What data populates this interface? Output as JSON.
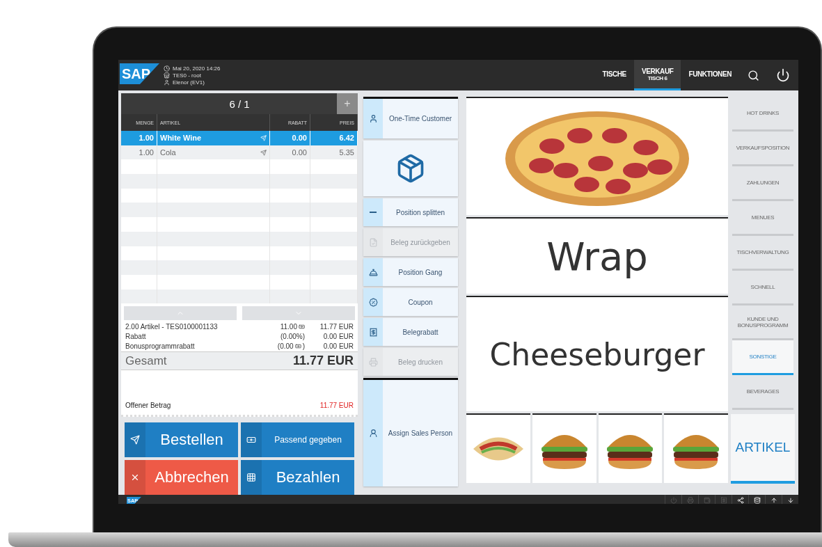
{
  "header": {
    "logo": "SAP",
    "datetime": "Mai 20, 2020 14:26",
    "store": "TES0 - root",
    "user": "Elenor (EV1)"
  },
  "nav": [
    {
      "label": "TISCHE",
      "selected": false
    },
    {
      "label": "VERKAUF",
      "sub": "TISCH 6",
      "selected": true
    },
    {
      "label": "FUNKTIONEN",
      "selected": false
    }
  ],
  "order": {
    "title": "6 / 1",
    "add": "+",
    "columns": [
      "MENGE",
      "ARTIKEL",
      "RABATT",
      "PREIS"
    ],
    "rows": [
      {
        "qty": "1.00",
        "item": "White Wine",
        "discount": "0.00",
        "price": "6.42",
        "selected": true
      },
      {
        "qty": "1.00",
        "item": "Cola",
        "discount": "0.00",
        "price": "5.35",
        "selected": false
      }
    ],
    "summary": [
      {
        "label": "2.00 Artikel - TES0100001133",
        "middle": "11.00",
        "amount": "11.77 EUR"
      },
      {
        "label": "Rabatt",
        "middle": "(0.00%)",
        "amount": "0.00 EUR"
      },
      {
        "label": "Bonusprogrammrabatt",
        "middle": "(0.00",
        "middle_suffix": ")",
        "amount": "0.00 EUR"
      }
    ],
    "total_label": "Gesamt",
    "total": "11.77 EUR",
    "open_label": "Offener Betrag",
    "open_amount": "11.77 EUR"
  },
  "buttons": [
    {
      "label": "Bestellen",
      "color": "#1f7fc4"
    },
    {
      "label": "Passend gegeben",
      "color": "#1f7fc4"
    },
    {
      "label": "Abbrechen",
      "color": "#ee5a47"
    },
    {
      "label": "Bezahlen",
      "color": "#1f7fc4"
    }
  ],
  "actions": [
    {
      "label": "One-Time Customer",
      "disabled": false
    },
    {
      "disabled": false
    },
    {
      "label": "Position splitten",
      "disabled": false
    },
    {
      "label": "Beleg zurückgeben",
      "disabled": true
    },
    {
      "label": "Position Gang",
      "disabled": false
    },
    {
      "label": "Coupon",
      "disabled": false
    },
    {
      "label": "Belegrabatt",
      "disabled": false
    },
    {
      "label": "Beleg drucken",
      "disabled": true
    },
    {
      "label": "Assign Sales Person",
      "disabled": false
    }
  ],
  "products": [
    {
      "kind": "photo"
    },
    {
      "kind": "text",
      "label": "Wrap"
    },
    {
      "kind": "text",
      "label": "Cheeseburger"
    }
  ],
  "product_photos": [
    {
      "kind": "wrap"
    },
    {
      "kind": "burger"
    },
    {
      "kind": "burger"
    },
    {
      "kind": "burger"
    }
  ],
  "categories": [
    {
      "label": "HOT DRINKS",
      "selected": false
    },
    {
      "label": "VERKAUFSPOSITION",
      "selected": false
    },
    {
      "label": "ZAHLUNGEN",
      "selected": false
    },
    {
      "label": "MENUES",
      "selected": false
    },
    {
      "label": "TISCHVERWALTUNG",
      "selected": false
    },
    {
      "label": "SCHNELL",
      "selected": false
    },
    {
      "label": "KUNDE UND BONUSPROGRAMM",
      "selected": false
    },
    {
      "label": "SONSTIGE",
      "selected": true
    },
    {
      "label": "BEVERAGES",
      "selected": false
    }
  ],
  "artikel": "ARTIKEL",
  "footer": {
    "logo": "SAP",
    "tools": [
      {
        "disabled": true
      },
      {
        "disabled": true
      },
      {
        "disabled": true
      },
      {
        "disabled": true
      },
      {
        "disabled": false
      },
      {
        "disabled": false
      },
      {
        "disabled": false
      },
      {
        "disabled": false
      }
    ]
  }
}
